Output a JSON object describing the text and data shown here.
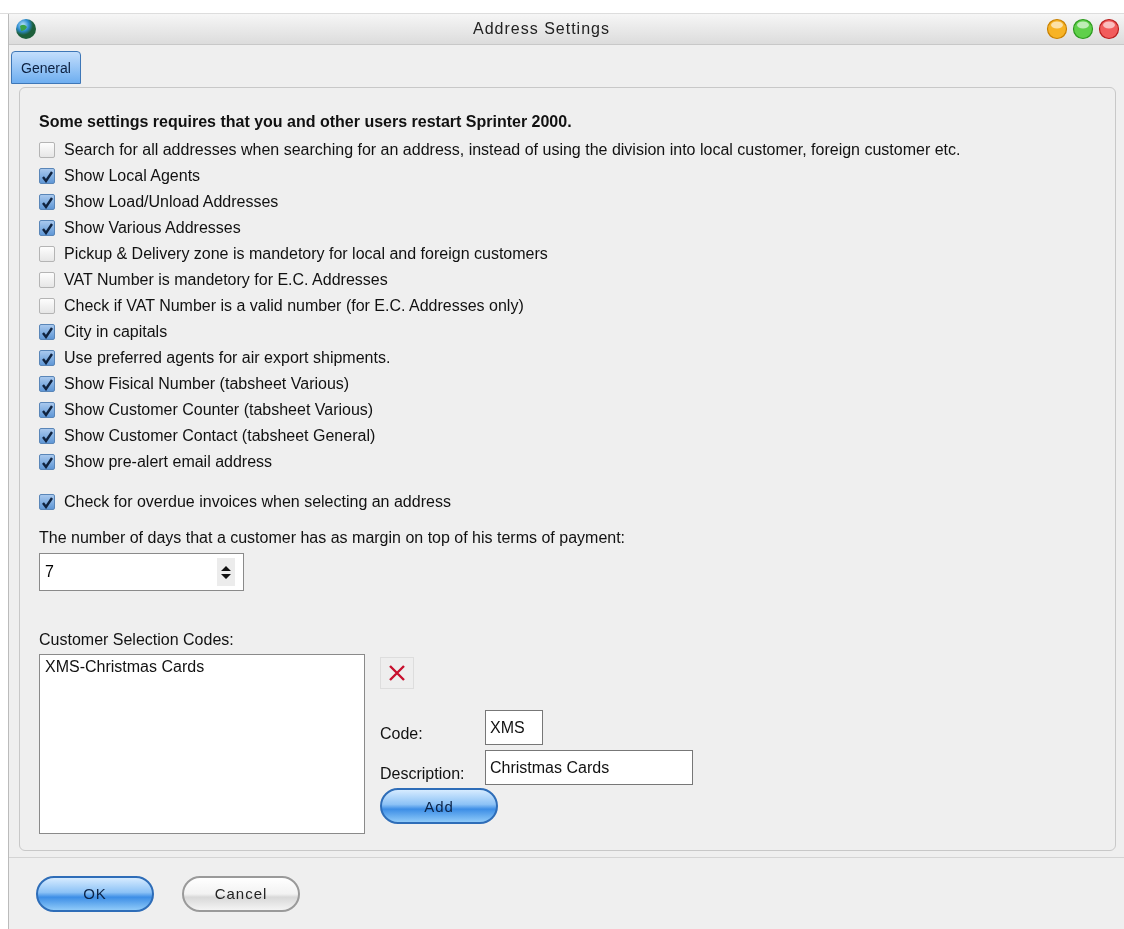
{
  "window": {
    "title": "Address Settings"
  },
  "tabs": [
    {
      "label": "General",
      "selected": true
    }
  ],
  "notice": "Some settings requires that you and other users restart Sprinter 2000.",
  "options": [
    {
      "label": "Search for all addresses when searching for an address, instead of using the division into local customer, foreign customer etc.",
      "checked": false
    },
    {
      "label": "Show Local Agents",
      "checked": true
    },
    {
      "label": "Show Load/Unload Addresses",
      "checked": true
    },
    {
      "label": "Show Various Addresses",
      "checked": true
    },
    {
      "label": "Pickup & Delivery zone is mandetory for local and foreign customers",
      "checked": false
    },
    {
      "label": "VAT Number is mandetory for E.C. Addresses",
      "checked": false
    },
    {
      "label": "Check if VAT Number is a valid number (for E.C. Addresses only)",
      "checked": false
    },
    {
      "label": "City in capitals",
      "checked": true
    },
    {
      "label": "Use preferred agents for air export shipments.",
      "checked": true
    },
    {
      "label": "Show Fisical Number (tabsheet Various)",
      "checked": true
    },
    {
      "label": "Show Customer Counter (tabsheet Various)",
      "checked": true
    },
    {
      "label": "Show Customer Contact (tabsheet General)",
      "checked": true
    },
    {
      "label": "Show pre-alert email address",
      "checked": true
    }
  ],
  "overdue_check": {
    "label": "Check for overdue invoices when selecting an address",
    "checked": true
  },
  "margin_days": {
    "label": "The number of days that a customer has as margin on top of his terms of payment:",
    "value": "7"
  },
  "selection_codes": {
    "label": "Customer Selection Codes:",
    "items": [
      {
        "text": "XMS-Christmas Cards",
        "selected": false
      }
    ],
    "code": {
      "label": "Code:",
      "value": "XMS"
    },
    "description": {
      "label": "Description:",
      "value": "Christmas Cards"
    },
    "add_button": "Add"
  },
  "buttons": [
    {
      "label": "OK",
      "kind": "default"
    },
    {
      "label": "Cancel",
      "kind": "normal"
    }
  ]
}
